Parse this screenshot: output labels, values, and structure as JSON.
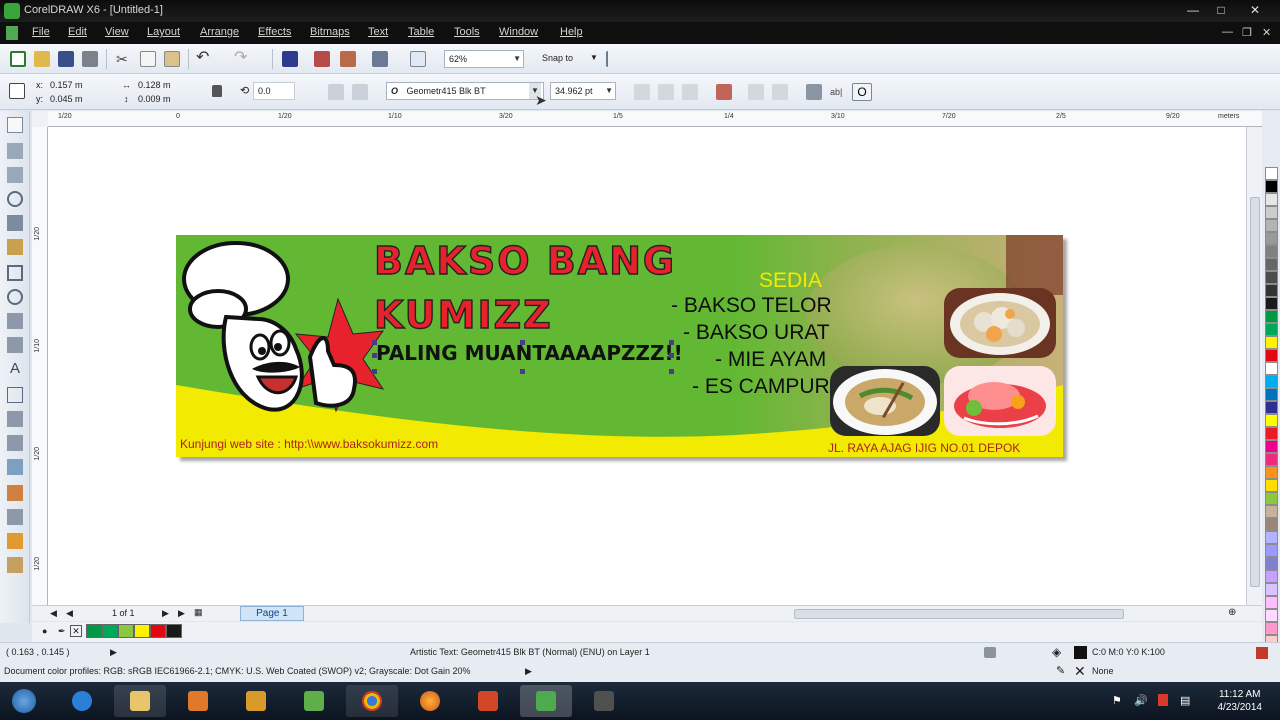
{
  "window": {
    "title": "CorelDRAW X6 - [Untitled-1]"
  },
  "menu": {
    "items": [
      "File",
      "Edit",
      "View",
      "Layout",
      "Arrange",
      "Effects",
      "Bitmaps",
      "Text",
      "Table",
      "Tools",
      "Window",
      "Help"
    ]
  },
  "standard_toolbar": {
    "zoom": "62%",
    "snap_to": "Snap to"
  },
  "property_bar": {
    "x_label": "x:",
    "x_value": "0.157 m",
    "y_label": "y:",
    "y_value": "0.045 m",
    "width": "0.128 m",
    "height": "0.009 m",
    "rotation": "0.0",
    "font_name": "Geometr415 Blk BT",
    "font_size": "34.962 pt"
  },
  "rulers": {
    "top_ticks": [
      "1/20",
      "0",
      "1/20",
      "1/10",
      "3/20",
      "1/5",
      "1/4",
      "3/10",
      "7/20",
      "2/5",
      "9/20"
    ],
    "unit": "meters",
    "left_ticks": [
      "1/20",
      "1/10",
      "1/20",
      "0",
      "1/20"
    ]
  },
  "banner": {
    "title_line1": "BAKSO BANG",
    "title_line2": "KUMIZZ",
    "tagline": "PALING MUANTAAAAPZZZ!!",
    "sedia": "SEDIA",
    "menu_items": [
      "- BAKSO TELOR",
      "- BAKSO URAT",
      "- MIE AYAM",
      "- ES CAMPUR"
    ],
    "website": "Kunjungi web site : http:\\\\www.baksokumizz.com",
    "address": "JL. RAYA AJAG IJIG NO.01 DEPOK",
    "colors": {
      "green": "#63b833",
      "yellow": "#f2ea00",
      "red": "#e8222c"
    }
  },
  "page_nav": {
    "counter": "1 of 1",
    "tab": "Page 1"
  },
  "status": {
    "coords": "( 0.163 , 0.145 )",
    "object_info": "Artistic Text: Geometr415 Blk BT (Normal) (ENU) on Layer 1",
    "fill_info": "C:0 M:0 Y:0 K:100",
    "outline_info": "None",
    "color_profiles": "Document color profiles: RGB: sRGB IEC61966-2.1; CMYK: U.S. Web Coated (SWOP) v2; Grayscale: Dot Gain 20%"
  },
  "taskbar": {
    "time": "11:12 AM",
    "date": "4/23/2014"
  },
  "palette_colors": [
    "#ffffff",
    "#000000",
    "#e6e6e6",
    "#cccccc",
    "#b3b3b3",
    "#999999",
    "#808080",
    "#666666",
    "#4d4d4d",
    "#333333",
    "#1a1a1a",
    "#009a44",
    "#00a859",
    "#fff200",
    "#e30613",
    "#ffffff",
    "#00aeef",
    "#0072bc",
    "#2e3192",
    "#ffff00",
    "#ed1c24",
    "#ec008c",
    "#ee2a7b",
    "#f7941d",
    "#ffdd00",
    "#8dc63f",
    "#c7b299",
    "#998675",
    "#b3b3ff",
    "#9999ff",
    "#8080cc",
    "#c6a0ff",
    "#d9c2ff",
    "#ffbdff",
    "#ffd9ff",
    "#ff99cc",
    "#ffcccc",
    "#e6e6ff"
  ],
  "doc_palette": [
    "#009a44",
    "#00a859",
    "#8dc63f",
    "#fff200",
    "#e30613",
    "#1a1a1a"
  ]
}
